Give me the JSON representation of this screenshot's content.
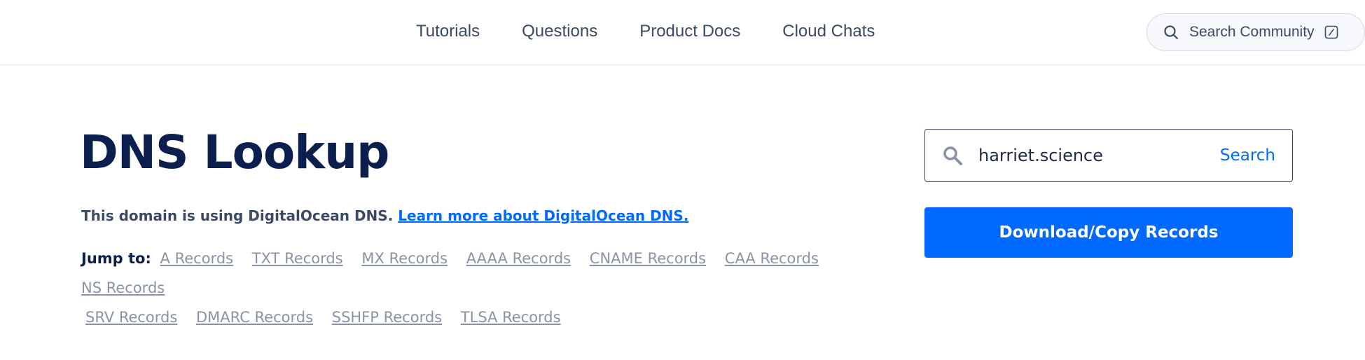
{
  "nav": {
    "links": [
      {
        "label": "Tutorials"
      },
      {
        "label": "Questions"
      },
      {
        "label": "Product Docs"
      },
      {
        "label": "Cloud Chats"
      }
    ],
    "community_search": {
      "placeholder": "Search Community",
      "icon": "search-icon",
      "shortcut_icon": "keyboard-shortcut-icon"
    }
  },
  "main": {
    "title": "DNS Lookup",
    "note_text": "This domain is using DigitalOcean DNS.",
    "note_link": "Learn more about DigitalOcean DNS.",
    "jump_label": "Jump to:",
    "jump_links_row1": [
      "A Records",
      "TXT Records",
      "MX Records",
      "AAAA Records",
      "CNAME Records",
      "CAA Records",
      "NS Records"
    ],
    "jump_links_row2": [
      "SRV Records",
      "DMARC Records",
      "SSHFP Records",
      "TLSA Records"
    ]
  },
  "search": {
    "value": "harriet.science",
    "button_label": "Search",
    "icon": "search-icon"
  },
  "download": {
    "label": "Download/Copy Records"
  },
  "colors": {
    "accent": "#0069ff",
    "title": "#0b1f4f",
    "muted_link": "#8a93a6",
    "text": "#3d4a66"
  }
}
